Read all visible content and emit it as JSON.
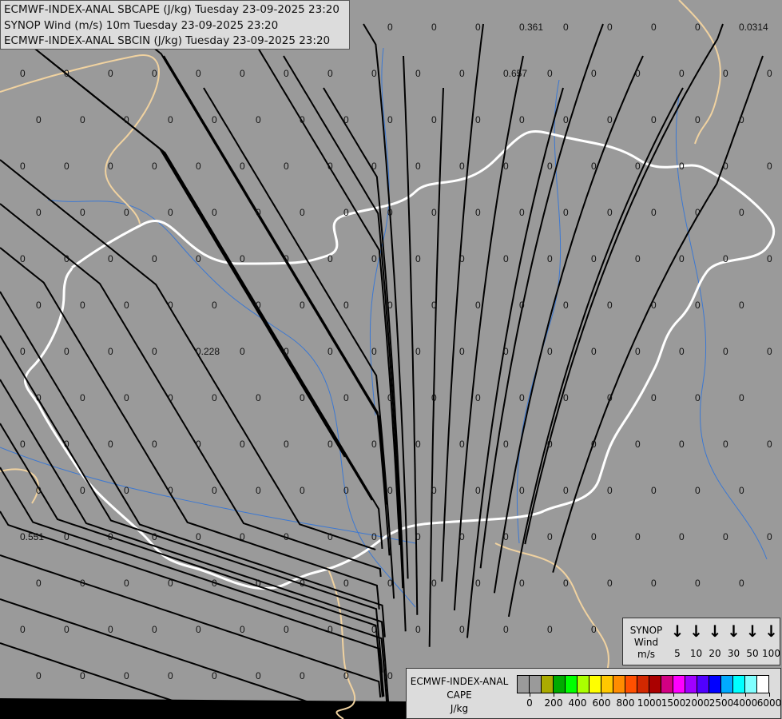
{
  "header": {
    "lines": [
      "ECMWF-INDEX-ANAL SBCAPE (J/kg) Tuesday 23-09-2025 23:20",
      "SYNOP Wind (m/s) 10m Tuesday 23-09-2025 23:20",
      "ECMWF-INDEX-ANAL SBCIN (J/kg) Tuesday 23-09-2025 23:20"
    ]
  },
  "synop_legend": {
    "title": "SYNOP",
    "subtitle": "Wind",
    "unit": "m/s",
    "icon": "arrow-down-icon",
    "speeds": [
      "5",
      "10",
      "20",
      "30",
      "50",
      "100"
    ]
  },
  "cape_legend": {
    "title": "ECMWF-INDEX-ANAL",
    "subtitle": "CAPE",
    "unit": "J/kg",
    "colors": [
      "#9a9a9a",
      "#9a9a9a",
      "#aaaa00",
      "#00aa00",
      "#00ff00",
      "#aaff00",
      "#ffff00",
      "#ffc800",
      "#ff8c00",
      "#ff5000",
      "#d22800",
      "#aa0000",
      "#d20082",
      "#ff00ff",
      "#a000ff",
      "#5000ff",
      "#0000ff",
      "#00aaff",
      "#00ffff",
      "#80ffff",
      "#ffffff"
    ],
    "labels": [
      "0",
      "200",
      "400",
      "600",
      "800",
      "1000",
      "1500",
      "2000",
      "2500",
      "4000",
      "6000"
    ]
  },
  "map": {
    "background": "#9a9a9a",
    "streamline_color": "#000000",
    "border_color": "#ffffff",
    "secondary_border_color": "#f0d2a0",
    "river_color": "#3c78d2",
    "grid_value_default": "0",
    "highlighted_values": [
      "0.361",
      "0.657",
      "0.0314",
      "0.228",
      "0.551"
    ]
  }
}
